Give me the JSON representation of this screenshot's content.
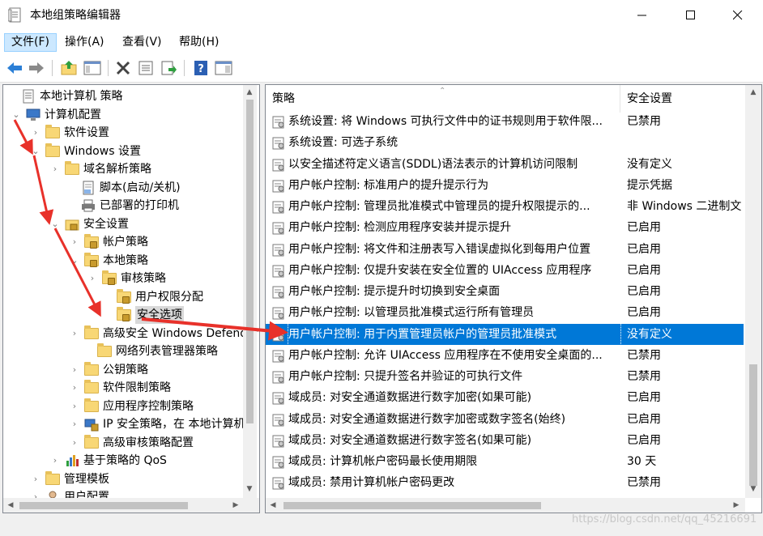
{
  "window": {
    "title": "本地组策略编辑器",
    "icon": "policy-editor-icon"
  },
  "menu": [
    {
      "label": "文件(F)",
      "active": true
    },
    {
      "label": "操作(A)"
    },
    {
      "label": "查看(V)"
    },
    {
      "label": "帮助(H)"
    }
  ],
  "toolbar": {
    "buttons": [
      "back-icon",
      "forward-icon",
      "up-folder-icon",
      "show-hide-tree-icon",
      "delete-icon",
      "properties-icon",
      "export-list-icon",
      "help-icon",
      "show-hide-action-pane-icon"
    ]
  },
  "tree": [
    {
      "label": "本地计算机 策略",
      "chev": "",
      "icon": "policy-icon"
    },
    {
      "label": "计算机配置",
      "chev": "⌄",
      "icon": "computer-icon"
    },
    {
      "label": "软件设置",
      "chev": "›",
      "icon": "folder-icon"
    },
    {
      "label": "Windows 设置",
      "chev": "⌄",
      "icon": "folder-icon"
    },
    {
      "label": "域名解析策略",
      "chev": "›",
      "icon": "folder-icon"
    },
    {
      "label": "脚本(启动/关机)",
      "chev": "",
      "icon": "script-icon"
    },
    {
      "label": "已部署的打印机",
      "chev": "",
      "icon": "printer-icon"
    },
    {
      "label": "安全设置",
      "chev": "⌄",
      "icon": "security-settings-icon"
    },
    {
      "label": "帐户策略",
      "chev": "›",
      "icon": "locked-folder-icon"
    },
    {
      "label": "本地策略",
      "chev": "⌄",
      "icon": "locked-folder-icon"
    },
    {
      "label": "审核策略",
      "chev": "›",
      "icon": "locked-folder-icon"
    },
    {
      "label": "用户权限分配",
      "chev": "",
      "icon": "locked-folder-icon"
    },
    {
      "label": "安全选项",
      "chev": "",
      "icon": "locked-folder-icon",
      "selected": true
    },
    {
      "label": "高级安全 Windows Defender 防火墙",
      "chev": "›",
      "icon": "folder-icon"
    },
    {
      "label": "网络列表管理器策略",
      "chev": "",
      "icon": "folder-icon"
    },
    {
      "label": "公钥策略",
      "chev": "›",
      "icon": "folder-icon"
    },
    {
      "label": "软件限制策略",
      "chev": "›",
      "icon": "folder-icon"
    },
    {
      "label": "应用程序控制策略",
      "chev": "›",
      "icon": "folder-icon"
    },
    {
      "label": "IP 安全策略，在 本地计算机",
      "chev": "›",
      "icon": "ip-security-icon"
    },
    {
      "label": "高级审核策略配置",
      "chev": "›",
      "icon": "folder-icon"
    },
    {
      "label": "基于策略的 QoS",
      "chev": "›",
      "icon": "qos-chart-icon"
    },
    {
      "label": "管理模板",
      "chev": "›",
      "icon": "folder-icon"
    },
    {
      "label": "用户配置",
      "chev": "›",
      "icon": "user-icon"
    }
  ],
  "columns": {
    "policy": "策略",
    "setting": "安全设置"
  },
  "policies": [
    {
      "name": "系统设置: 将 Windows 可执行文件中的证书规则用于软件限...",
      "value": "已禁用"
    },
    {
      "name": "系统设置: 可选子系统",
      "value": ""
    },
    {
      "name": "以安全描述符定义语言(SDDL)语法表示的计算机访问限制",
      "value": "没有定义"
    },
    {
      "name": "用户帐户控制: 标准用户的提升提示行为",
      "value": "提示凭据"
    },
    {
      "name": "用户帐户控制: 管理员批准模式中管理员的提升权限提示的...",
      "value": "非 Windows 二进制文"
    },
    {
      "name": "用户帐户控制: 检测应用程序安装并提示提升",
      "value": "已启用"
    },
    {
      "name": "用户帐户控制: 将文件和注册表写入错误虚拟化到每用户位置",
      "value": "已启用"
    },
    {
      "name": "用户帐户控制: 仅提升安装在安全位置的 UIAccess 应用程序",
      "value": "已启用"
    },
    {
      "name": "用户帐户控制: 提示提升时切换到安全桌面",
      "value": "已启用"
    },
    {
      "name": "用户帐户控制: 以管理员批准模式运行所有管理员",
      "value": "已启用"
    },
    {
      "name": "用户帐户控制: 用于内置管理员帐户的管理员批准模式",
      "value": "没有定义",
      "selected": true
    },
    {
      "name": "用户帐户控制: 允许 UIAccess 应用程序在不使用安全桌面的...",
      "value": "已禁用"
    },
    {
      "name": "用户帐户控制: 只提升签名并验证的可执行文件",
      "value": "已禁用"
    },
    {
      "name": "域成员: 对安全通道数据进行数字加密(如果可能)",
      "value": "已启用"
    },
    {
      "name": "域成员: 对安全通道数据进行数字加密或数字签名(始终)",
      "value": "已启用"
    },
    {
      "name": "域成员: 对安全通道数据进行数字签名(如果可能)",
      "value": "已启用"
    },
    {
      "name": "域成员: 计算机帐户密码最长使用期限",
      "value": "30 天"
    },
    {
      "name": "域成员: 禁用计算机帐户密码更改",
      "value": "已禁用"
    }
  ],
  "watermark": "https://blog.csdn.net/qq_45216691",
  "colors": {
    "selection": "#0078d7",
    "annotation_arrow": "#e8312a"
  }
}
